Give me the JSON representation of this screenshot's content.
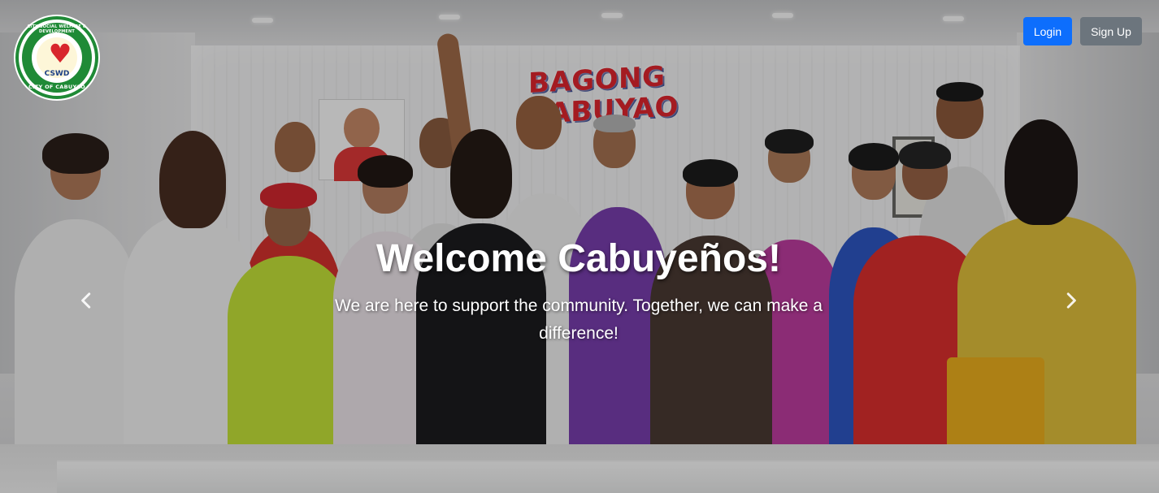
{
  "brand": {
    "logo_alt": "CSWD logo",
    "logo_top_text": "CITY SOCIAL WELFARE & DEVELOPMENT",
    "logo_abbr": "CSWD",
    "logo_bottom_text": "CITY OF CABUYAO"
  },
  "nav": {
    "login_label": "Login",
    "signup_label": "Sign Up",
    "login_color": "#0d6efd",
    "signup_color": "#6c757d"
  },
  "hero": {
    "title": "Welcome Cabuyeños!",
    "subtitle": "We are here to support the community. Together, we can make a difference!",
    "background_sign_text": "BAGONG CABUYAO",
    "prev_icon": "chevron-left-icon",
    "next_icon": "chevron-right-icon"
  }
}
